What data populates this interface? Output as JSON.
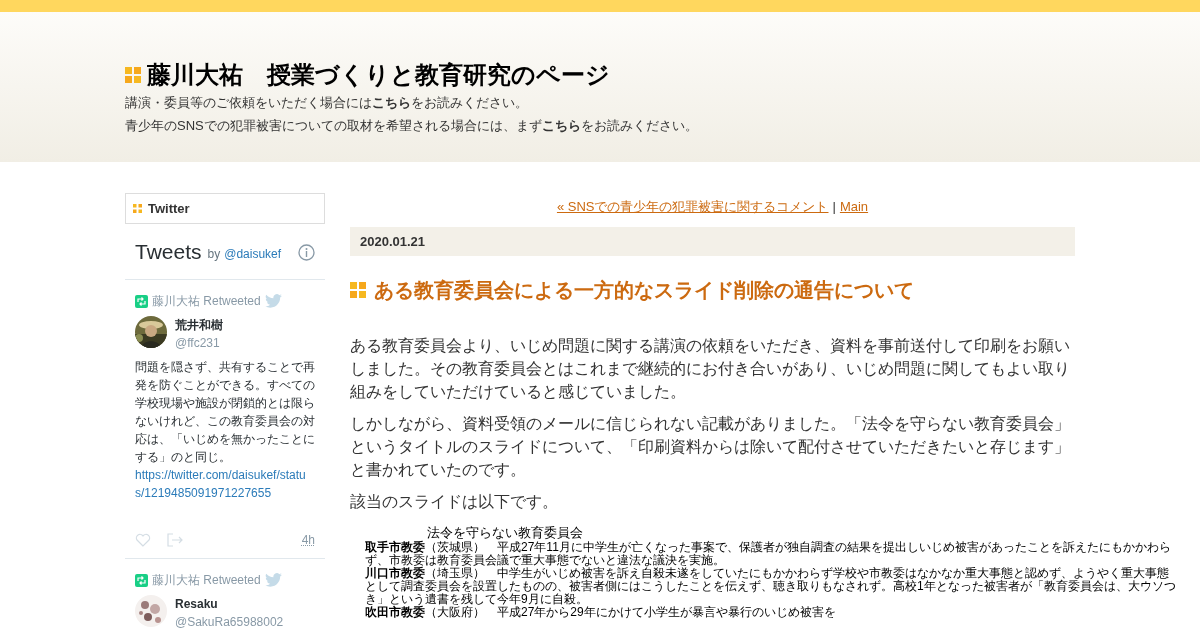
{
  "header": {
    "title": "藤川大祐　授業づくりと教育研究のページ",
    "lines": [
      "講演・委員等のご依頼をいただく場合には**こちら**をお読みください。",
      "青少年のSNSでの犯罪被害についての取材を希望される場合には、まず**こちら**をお読みください。"
    ]
  },
  "sidebar": {
    "heading": "Twitter",
    "timeline": {
      "title": "Tweets",
      "by": "by",
      "handle": "@daisukef",
      "tweets": [
        {
          "retweeted": "藤川大祐 Retweeted",
          "name": "荒井和樹",
          "handle": "@ffc231",
          "text": "問題を隠さず、共有することで再発を防ぐことができる。すべての学校現場や施設が閉鎖的とは限らないけれど、この教育委員会の対応は、「いじめを無かったことにする」のと同じ。",
          "link": "https://twitter.com/daisukef/status/1219485091971227655",
          "time": "4h"
        },
        {
          "retweeted": "藤川大祐 Retweeted",
          "name": "Resaku",
          "handle": "@SakuRa65988002"
        }
      ]
    }
  },
  "main": {
    "nav": {
      "prev": "« SNSでの青少年の犯罪被害に関するコメント",
      "separator": "|",
      "home": "Main"
    },
    "date": "2020.01.21",
    "title": "ある教育委員会による一方的なスライド削除の通告について",
    "paragraphs": [
      "ある教育委員会より、いじめ問題に関する講演の依頼をいただき、資料を事前送付して印刷をお願いしました。その教育委員会とはこれまで継続的にお付き合いがあり、いじめ問題に関してもよい取り組みをしていただけていると感じていました。",
      "しかしながら、資料受領のメールに信じられない記載がありました。「法令を守らない教育委員会」というタイトルのスライドについて、「印刷資料からは除いて配付させていただきたいと存じます」と書かれていたのです。",
      "該当のスライドは以下です。"
    ],
    "slide": {
      "title": "法令を守らない教育委員会",
      "items": [
        "**取手市教委**（茨城県）　平成27年11月に中学生が亡くなった事案で、保護者が独自調査の結果を提出しいじめ被害があったことを訴えたにもかかわらず、市教委は教育委員会議で重大事態でないと違法な議決を実施。",
        "**川口市教委**（埼玉県）　中学生がいじめ被害を訴え自殺未遂をしていたにもかかわらず学校や市教委はなかなか重大事態と認めず、ようやく重大事態として調査委員会を設置したものの、被害者側にはこうしたことを伝えず、聴き取りもなされず。高校1年となった被害者が「教育委員会は、大ウソつき」という遺書を残して今年9月に自殺。",
        "**吹田市教委**（大阪府）　平成27年から29年にかけて小学生が暴言や暴行のいじめ被害を"
      ]
    }
  }
}
